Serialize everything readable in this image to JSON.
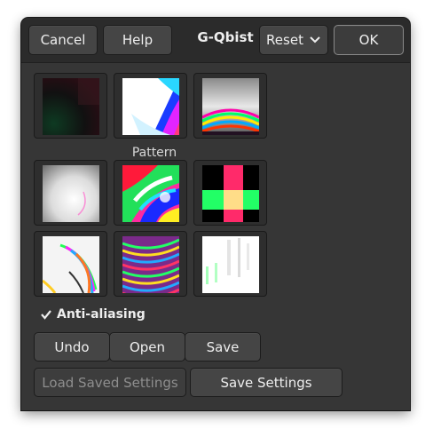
{
  "header": {
    "cancel_label": "Cancel",
    "help_label": "Help",
    "title": "G-Qbist",
    "reset_label": "Reset",
    "ok_label": "OK"
  },
  "pattern": {
    "label": "Pattern",
    "thumbnails": [
      "dark-green-red-gradient",
      "white-blue-magenta-swirl",
      "grey-rainbow-rings",
      "grey-white-radial",
      "rainbow-psychedelic-swirl",
      "red-green-pink-blocks",
      "white-rainbow-wave",
      "rainbow-concentric-lines",
      "white-green-stripes"
    ]
  },
  "anti_aliasing": {
    "label": "Anti-aliasing",
    "checked": true
  },
  "buttons": {
    "undo_label": "Undo",
    "open_label": "Open",
    "save_label": "Save",
    "load_saved_label": "Load Saved Settings",
    "save_settings_label": "Save Settings"
  },
  "colors": {
    "window_bg": "#363636",
    "header_bg": "#2b2b2b",
    "button_bg": "#454545",
    "text": "#eeeeee",
    "disabled_text": "#8e8e8e"
  }
}
